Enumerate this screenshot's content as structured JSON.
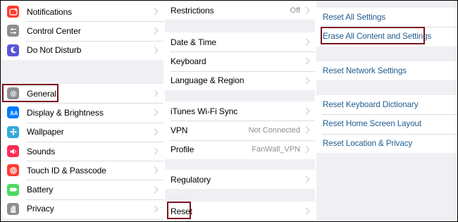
{
  "column1": {
    "items": [
      {
        "label": "Notifications",
        "icon": "notifications-icon",
        "color": "#ff3b30"
      },
      {
        "label": "Control Center",
        "icon": "control-center-icon",
        "color": "#8e8e93"
      },
      {
        "label": "Do Not Disturb",
        "icon": "moon-icon",
        "color": "#5856d6"
      },
      {
        "label": "General",
        "icon": "gear-icon",
        "color": "#8e8e93"
      },
      {
        "label": "Display & Brightness",
        "icon": "display-icon",
        "color": "#007aff"
      },
      {
        "label": "Wallpaper",
        "icon": "wallpaper-icon",
        "color": "#34aadc"
      },
      {
        "label": "Sounds",
        "icon": "speaker-icon",
        "color": "#ff2d55"
      },
      {
        "label": "Touch ID & Passcode",
        "icon": "fingerprint-icon",
        "color": "#ff3b30"
      },
      {
        "label": "Battery",
        "icon": "battery-icon",
        "color": "#4cd964"
      },
      {
        "label": "Privacy",
        "icon": "hand-icon",
        "color": "#8e8e93"
      }
    ]
  },
  "column2": {
    "restrictions": {
      "label": "Restrictions",
      "value": "Off"
    },
    "date_time": {
      "label": "Date & Time"
    },
    "keyboard": {
      "label": "Keyboard"
    },
    "language_region": {
      "label": "Language & Region"
    },
    "itunes_wifi_sync": {
      "label": "iTunes Wi-Fi Sync"
    },
    "vpn": {
      "label": "VPN",
      "value": "Not Connected"
    },
    "profile": {
      "label": "Profile",
      "value": "FanWall_VPN"
    },
    "regulatory": {
      "label": "Regulatory"
    },
    "reset": {
      "label": "Reset"
    }
  },
  "column3": {
    "reset_all_settings": "Reset All Settings",
    "erase_all": "Erase All Content and Settings",
    "reset_network": "Reset Network Settings",
    "reset_keyboard_dictionary": "Reset Keyboard Dictionary",
    "reset_home_screen": "Reset Home Screen Layout",
    "reset_location_privacy": "Reset Location & Privacy"
  },
  "colors": {
    "highlight_border": "#7b1420",
    "link_blue": "#1f5c8f",
    "group_bg": "#efeff4"
  }
}
